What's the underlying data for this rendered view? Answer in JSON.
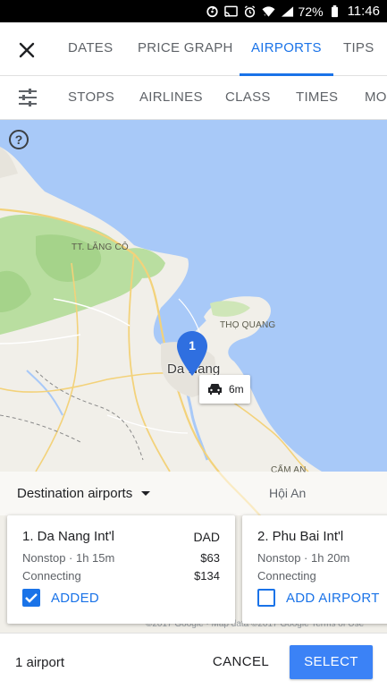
{
  "status_bar": {
    "battery_percent": "72%",
    "time": "11:46",
    "icons": [
      "sync-icon",
      "cast-icon",
      "alarm-icon",
      "wifi-icon",
      "signal-icon",
      "battery-icon"
    ]
  },
  "tabs": [
    {
      "label": "DATES",
      "active": false
    },
    {
      "label": "PRICE GRAPH",
      "active": false
    },
    {
      "label": "AIRPORTS",
      "active": true
    },
    {
      "label": "TIPS",
      "active": false
    }
  ],
  "filters": [
    {
      "label": "STOPS"
    },
    {
      "label": "AIRLINES"
    },
    {
      "label": "CLASS"
    },
    {
      "label": "TIMES"
    },
    {
      "label": "MORE"
    }
  ],
  "map": {
    "labels": {
      "lang_co": "TT. LĂNG CÔ",
      "tho_quang": "THỌ QUANG",
      "cam_an": "CẨM AN",
      "da_nang": "Da Nang",
      "hoi_an": "Hội An"
    },
    "pin_number": "1",
    "drive_time": "6m",
    "attribution": "©2017 Google · Map data ©2017 Google    Terms of Use"
  },
  "destination": {
    "dropdown_label": "Destination airports"
  },
  "airports": [
    {
      "name": "1. Da Nang Int'l",
      "code": "DAD",
      "nonstop": "Nonstop · 1h 15m",
      "nonstop_price": "$63",
      "connecting": "Connecting",
      "connecting_price": "$134",
      "action": "ADDED",
      "checked": true
    },
    {
      "name": "2. Phu Bai Int'l",
      "nonstop": "Nonstop · 1h 20m",
      "connecting": "Connecting",
      "action": "ADD AIRPORT",
      "checked": false
    }
  ],
  "footer": {
    "count": "1 airport",
    "cancel": "CANCEL",
    "select": "SELECT"
  },
  "colors": {
    "accent": "#1a73e8",
    "select_button": "#3b82f6",
    "water": "#a8c9f8",
    "pin": "#2f6fe0"
  }
}
